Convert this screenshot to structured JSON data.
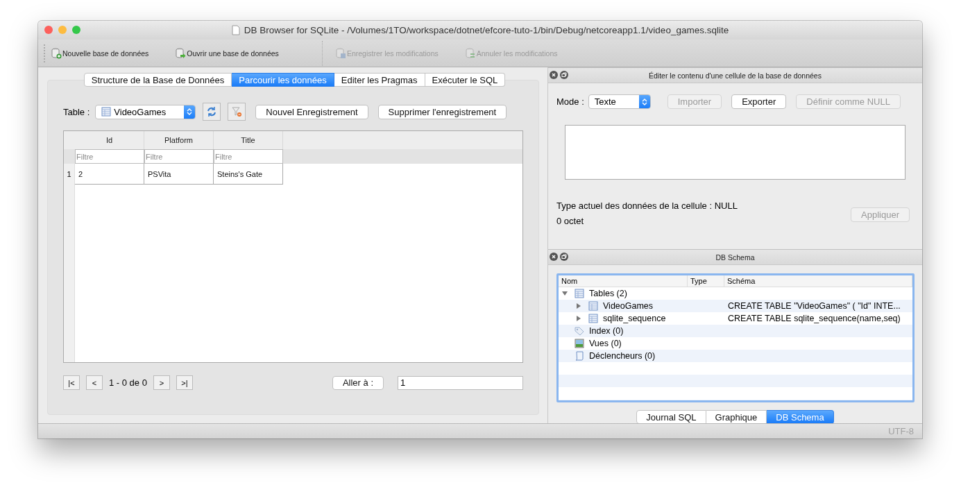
{
  "window": {
    "title": "DB Browser for SQLite - /Volumes/1TO/workspace/dotnet/efcore-tuto-1/bin/Debug/netcoreapp1.1/video_games.sqlite"
  },
  "toolbar": [
    {
      "label": "Nouvelle base de données",
      "kind": "new",
      "disabled": false
    },
    {
      "label": "Ouvrir une base de données",
      "kind": "open",
      "disabled": false
    },
    {
      "label": "Enregistrer les modifications",
      "kind": "save",
      "disabled": true
    },
    {
      "label": "Annuler les modifications",
      "kind": "revert",
      "disabled": true
    }
  ],
  "tabs": [
    {
      "label": "Structure de la Base de Données",
      "selected": false
    },
    {
      "label": "Parcourir les données",
      "selected": true
    },
    {
      "label": "Editer les Pragmas",
      "selected": false
    },
    {
      "label": "Exécuter le SQL",
      "selected": false
    }
  ],
  "browse": {
    "table_label": "Table :",
    "table_value": "VideoGames",
    "buttons": [
      {
        "label": "Nouvel Enregistrement"
      },
      {
        "label": "Supprimer l'enregistrement"
      }
    ],
    "table": {
      "columns": [
        {
          "label": "Id",
          "filter_placeholder": "Filtre"
        },
        {
          "label": "Platform",
          "filter_placeholder": "Filtre"
        },
        {
          "label": "Title",
          "filter_placeholder": "Filtre"
        }
      ],
      "rows": [
        {
          "number": "1",
          "cells": [
            "2",
            "PSVita",
            "Steins's Gate"
          ]
        }
      ]
    },
    "pager": {
      "first": "|<",
      "prev": "<",
      "status": "1 - 0 de 0",
      "next": ">",
      "last": ">|",
      "goto_label": "Aller à :",
      "goto_value": "1"
    }
  },
  "cell_editor": {
    "title": "Éditer le contenu d'une cellule de la base de données",
    "mode_label": "Mode :",
    "mode_value": "Texte",
    "buttons": [
      {
        "label": "Importer",
        "disabled": true
      },
      {
        "label": "Exporter",
        "disabled": false
      },
      {
        "label": "Définir comme NULL",
        "disabled": true
      }
    ],
    "type_text": "Type actuel des données de la cellule : NULL",
    "size_text": "0 octet",
    "apply": {
      "label": "Appliquer",
      "disabled": true
    }
  },
  "schema": {
    "title": "DB Schema",
    "columns": [
      "Nom",
      "Type",
      "Schéma"
    ],
    "items": [
      {
        "name": "Tables (2)",
        "kind": "tables",
        "expanded": true,
        "children": [
          {
            "name": "VideoGames",
            "kind": "table",
            "expanded": false,
            "schema": "CREATE TABLE \"VideoGames\" ( \"Id\" INTE..."
          },
          {
            "name": "sqlite_sequence",
            "kind": "table",
            "expanded": false,
            "schema": "CREATE TABLE sqlite_sequence(name,seq)"
          }
        ]
      },
      {
        "name": "Index (0)",
        "kind": "index"
      },
      {
        "name": "Vues (0)",
        "kind": "view"
      },
      {
        "name": "Déclencheurs (0)",
        "kind": "trigger"
      }
    ]
  },
  "bottom_tabs": [
    {
      "label": "Journal SQL",
      "selected": false
    },
    {
      "label": "Graphique",
      "selected": false
    },
    {
      "label": "DB Schema",
      "selected": true
    }
  ],
  "status_bar": {
    "encoding": "UTF-8"
  }
}
